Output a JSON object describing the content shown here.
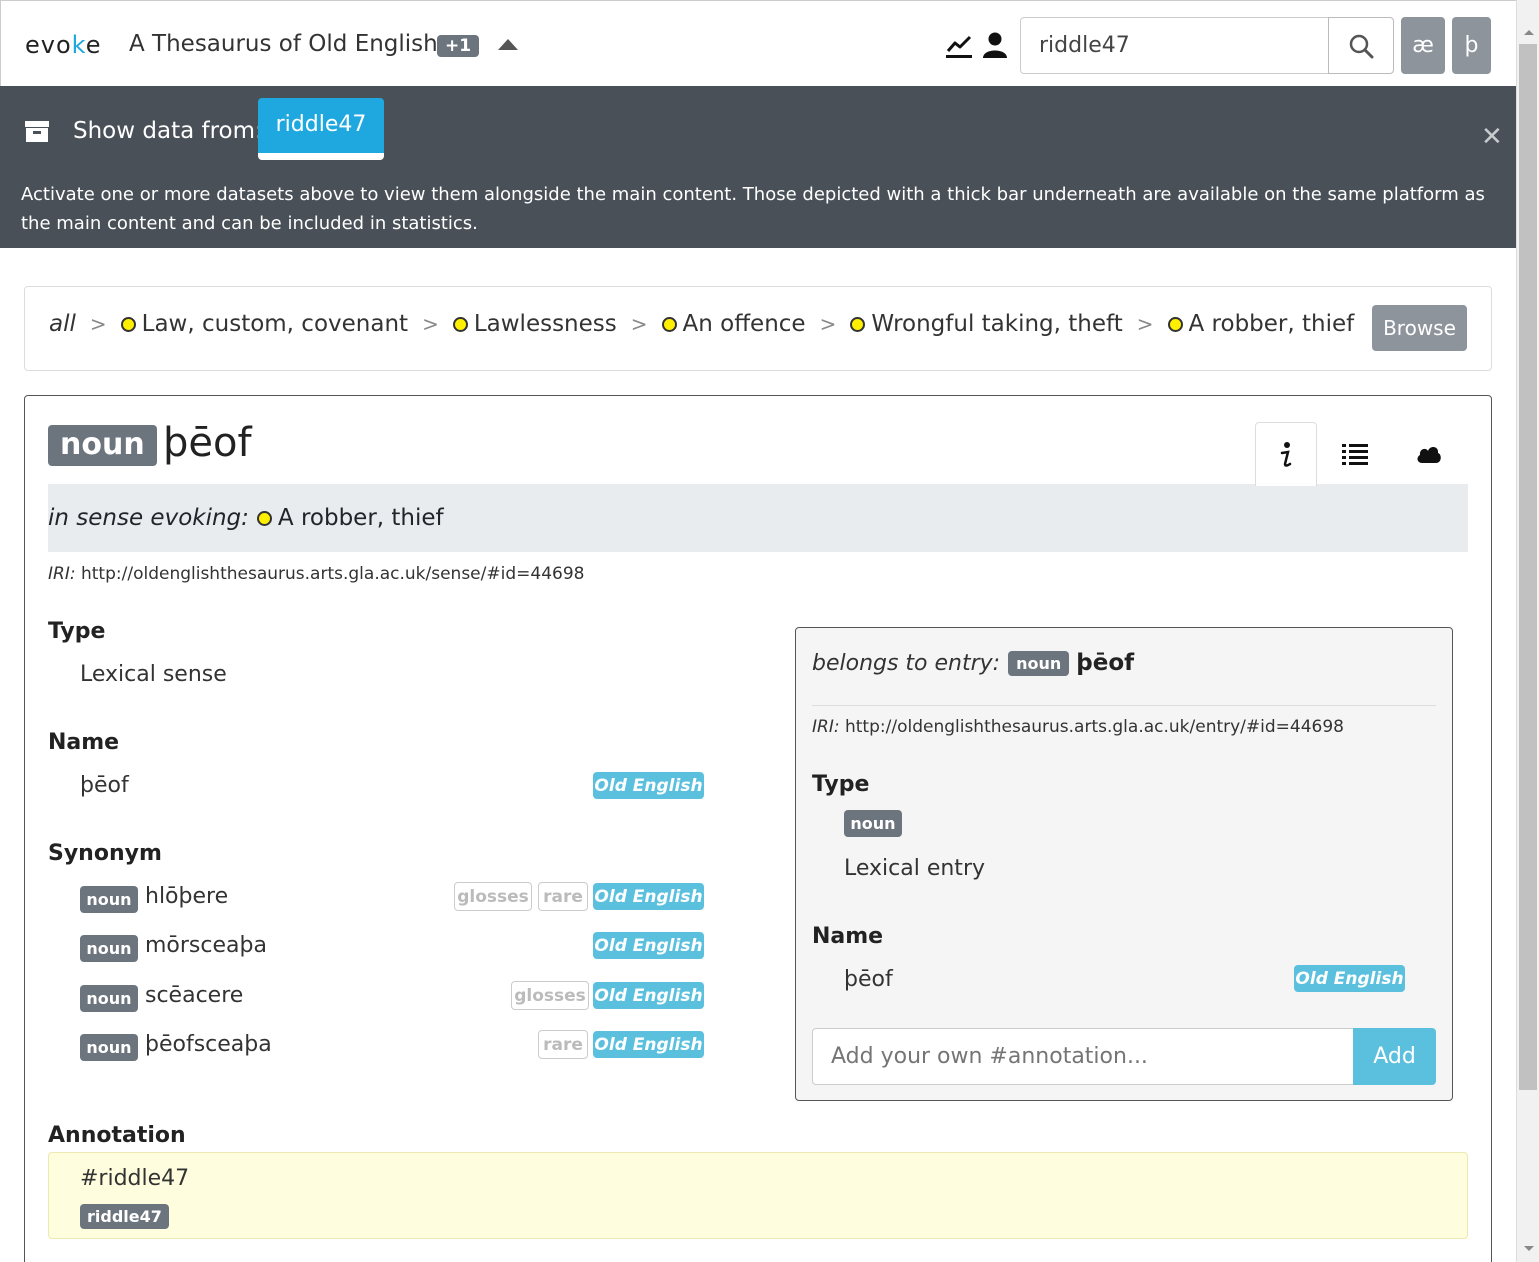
{
  "app": {
    "logo": "evoke",
    "title": "A Thesaurus of Old English",
    "more_badge": "+1"
  },
  "search": {
    "value": "riddle47",
    "placeholder": ""
  },
  "char_buttons": [
    "æ",
    "þ"
  ],
  "dataset_bar": {
    "label": "Show data from:",
    "dataset": "riddle47",
    "info": "Activate one or more datasets above to view them alongside the main content. Those depicted with a thick bar underneath are available on the same platform as the main content and can be included in statistics."
  },
  "breadcrumb": {
    "root": "all",
    "items": [
      "Law, custom, covenant",
      "Lawlessness",
      "An offence",
      "Wrongful taking, theft",
      "A robber, thief"
    ],
    "browse_label": "Browse"
  },
  "sense": {
    "pos": "noun",
    "word": "þēof",
    "evoking_label": "in sense evoking:",
    "evoking_value": "A robber, thief",
    "iri_label": "IRI:",
    "iri": "http://oldenglishthesaurus.arts.gla.ac.uk/sense/#id=44698",
    "type_label": "Type",
    "type_value": "Lexical sense",
    "name_label": "Name",
    "name_value": "þēof",
    "name_lang": "Old English",
    "synonym_label": "Synonym",
    "synonyms": [
      {
        "pos": "noun",
        "word": "hlōþere",
        "tags": [
          "glosses",
          "rare"
        ],
        "lang": "Old English"
      },
      {
        "pos": "noun",
        "word": "mōrsceaþa",
        "tags": [],
        "lang": "Old English"
      },
      {
        "pos": "noun",
        "word": "scēacere",
        "tags": [
          "glosses"
        ],
        "lang": "Old English"
      },
      {
        "pos": "noun",
        "word": "þēofsceaþa",
        "tags": [
          "rare"
        ],
        "lang": "Old English"
      }
    ],
    "annotation_label": "Annotation",
    "annotation_text": "#riddle47",
    "annotation_tag": "riddle47"
  },
  "entry": {
    "belongs_label": "belongs to entry:",
    "pos": "noun",
    "word": "þēof",
    "iri_label": "IRI:",
    "iri": "http://oldenglishthesaurus.arts.gla.ac.uk/entry/#id=44698",
    "type_label": "Type",
    "type_pos": "noun",
    "type_value": "Lexical entry",
    "name_label": "Name",
    "name_value": "þēof",
    "name_lang": "Old English",
    "annot_placeholder": "Add your own #annotation...",
    "add_label": "Add"
  },
  "colors": {
    "accent": "#1fa8e0",
    "dark_bar": "#495057",
    "badge_gray": "#6c757d",
    "lang_badge": "#5bc0de",
    "category_dot": "#ffef00",
    "annotation_bg": "#fefede"
  },
  "icons": [
    "line-chart-icon",
    "user-icon",
    "search-icon",
    "archive-icon",
    "close-icon",
    "info-icon",
    "list-icon",
    "cloud-icon"
  ]
}
